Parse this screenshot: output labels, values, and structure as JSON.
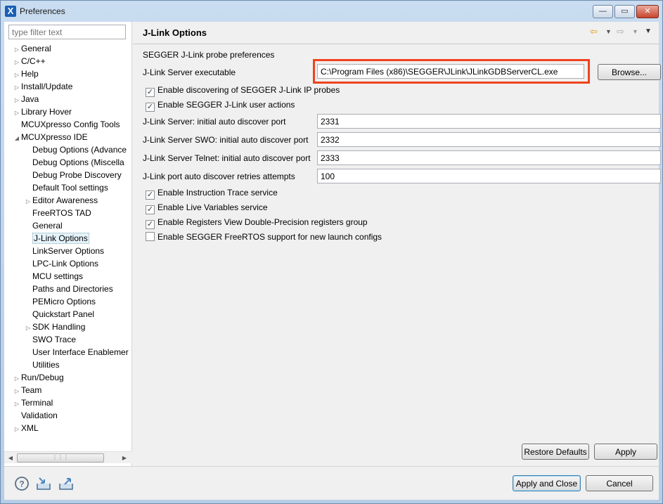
{
  "window": {
    "title": "Preferences",
    "app_icon": "X",
    "controls": {
      "minimize": "—",
      "maximize": "▭",
      "close": "✕"
    }
  },
  "filter": {
    "placeholder": "type filter text"
  },
  "tree": {
    "items": [
      {
        "label": "General",
        "level": 0,
        "expandable": true
      },
      {
        "label": "C/C++",
        "level": 0,
        "expandable": true
      },
      {
        "label": "Help",
        "level": 0,
        "expandable": true
      },
      {
        "label": "Install/Update",
        "level": 0,
        "expandable": true
      },
      {
        "label": "Java",
        "level": 0,
        "expandable": true
      },
      {
        "label": "Library Hover",
        "level": 0,
        "expandable": true
      },
      {
        "label": "MCUXpresso Config Tools",
        "level": 0,
        "expandable": false
      },
      {
        "label": "MCUXpresso IDE",
        "level": 0,
        "expandable": true,
        "expanded": true
      },
      {
        "label": "Debug Options (Advance",
        "level": 1,
        "expandable": false
      },
      {
        "label": "Debug Options (Miscella",
        "level": 1,
        "expandable": false
      },
      {
        "label": "Debug Probe Discovery",
        "level": 1,
        "expandable": false
      },
      {
        "label": "Default Tool settings",
        "level": 1,
        "expandable": false
      },
      {
        "label": "Editor Awareness",
        "level": 1,
        "expandable": true
      },
      {
        "label": "FreeRTOS TAD",
        "level": 1,
        "expandable": false
      },
      {
        "label": "General",
        "level": 1,
        "expandable": false
      },
      {
        "label": "J-Link Options",
        "level": 1,
        "expandable": false,
        "selected": true
      },
      {
        "label": "LinkServer Options",
        "level": 1,
        "expandable": false
      },
      {
        "label": "LPC-Link Options",
        "level": 1,
        "expandable": false
      },
      {
        "label": "MCU settings",
        "level": 1,
        "expandable": false
      },
      {
        "label": "Paths and Directories",
        "level": 1,
        "expandable": false
      },
      {
        "label": "PEMicro Options",
        "level": 1,
        "expandable": false
      },
      {
        "label": "Quickstart Panel",
        "level": 1,
        "expandable": false
      },
      {
        "label": "SDK Handling",
        "level": 1,
        "expandable": true
      },
      {
        "label": "SWO Trace",
        "level": 1,
        "expandable": false
      },
      {
        "label": "User Interface Enablemer",
        "level": 1,
        "expandable": false
      },
      {
        "label": "Utilities",
        "level": 1,
        "expandable": false
      },
      {
        "label": "Run/Debug",
        "level": 0,
        "expandable": true
      },
      {
        "label": "Team",
        "level": 0,
        "expandable": true
      },
      {
        "label": "Terminal",
        "level": 0,
        "expandable": true
      },
      {
        "label": "Validation",
        "level": 0,
        "expandable": false
      },
      {
        "label": "XML",
        "level": 0,
        "expandable": true
      }
    ]
  },
  "page": {
    "title": "J-Link Options",
    "description": "SEGGER J-Link probe preferences",
    "server_exe_label": "J-Link Server executable",
    "server_exe_value": "C:\\Program Files (x86)\\SEGGER\\JLink\\JLinkGDBServerCL.exe",
    "browse_label": "Browse...",
    "checks_top": [
      {
        "label": "Enable discovering of SEGGER J-Link IP probes",
        "checked": true
      },
      {
        "label": "Enable SEGGER J-Link user actions",
        "checked": true
      }
    ],
    "ports": [
      {
        "label": "J-Link Server: initial auto discover port",
        "value": "2331"
      },
      {
        "label": "J-Link Server SWO: initial auto discover port",
        "value": "2332"
      },
      {
        "label": "J-Link Server Telnet: initial auto discover port",
        "value": "2333"
      },
      {
        "label": "J-Link port auto discover retries attempts",
        "value": "100"
      }
    ],
    "checks_bottom": [
      {
        "label": "Enable Instruction Trace service",
        "checked": true
      },
      {
        "label": "Enable Live Variables service",
        "checked": true
      },
      {
        "label": "Enable Registers View Double-Precision registers group",
        "checked": true
      },
      {
        "label": "Enable SEGGER FreeRTOS support for new launch configs",
        "checked": false
      }
    ],
    "restore_defaults_label": "Restore Defaults",
    "apply_label": "Apply",
    "highlight_color": "#f0421e"
  },
  "footer": {
    "apply_close_label": "Apply and Close",
    "cancel_label": "Cancel",
    "icons": [
      "help-icon",
      "import-icon",
      "export-icon"
    ]
  }
}
